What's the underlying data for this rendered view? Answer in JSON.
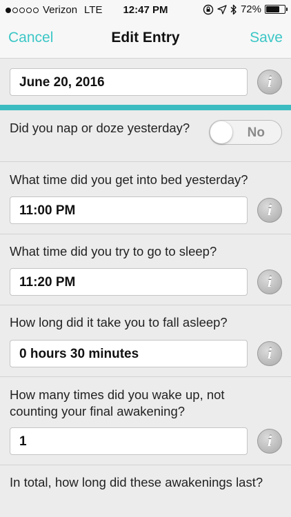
{
  "status_bar": {
    "carrier": "Verizon",
    "network": "LTE",
    "time": "12:47 PM",
    "battery_percent": "72%",
    "battery_level": 0.72
  },
  "nav": {
    "cancel_label": "Cancel",
    "title": "Edit Entry",
    "save_label": "Save"
  },
  "date_field": {
    "value": "June 20, 2016"
  },
  "questions": {
    "nap": {
      "text": "Did you nap or doze yesterday?",
      "toggle_label": "No"
    },
    "bed_time": {
      "text": "What time did you get into bed yesterday?",
      "value": "11:00 PM"
    },
    "sleep_try": {
      "text": "What time did you try to go to sleep?",
      "value": "11:20 PM"
    },
    "fall_asleep": {
      "text": "How long did it take you to fall asleep?",
      "value": "0 hours 30 minutes"
    },
    "wake_count": {
      "text": "How many times did you wake up, not counting your final awakening?",
      "value": "1"
    },
    "awakenings_total": {
      "text": "In total, how long did these awakenings last?"
    }
  },
  "info_icon_glyph": "i",
  "colors": {
    "accent": "#3cc6c6",
    "teal_bar": "#3cbcc1",
    "background": "#ececec"
  }
}
